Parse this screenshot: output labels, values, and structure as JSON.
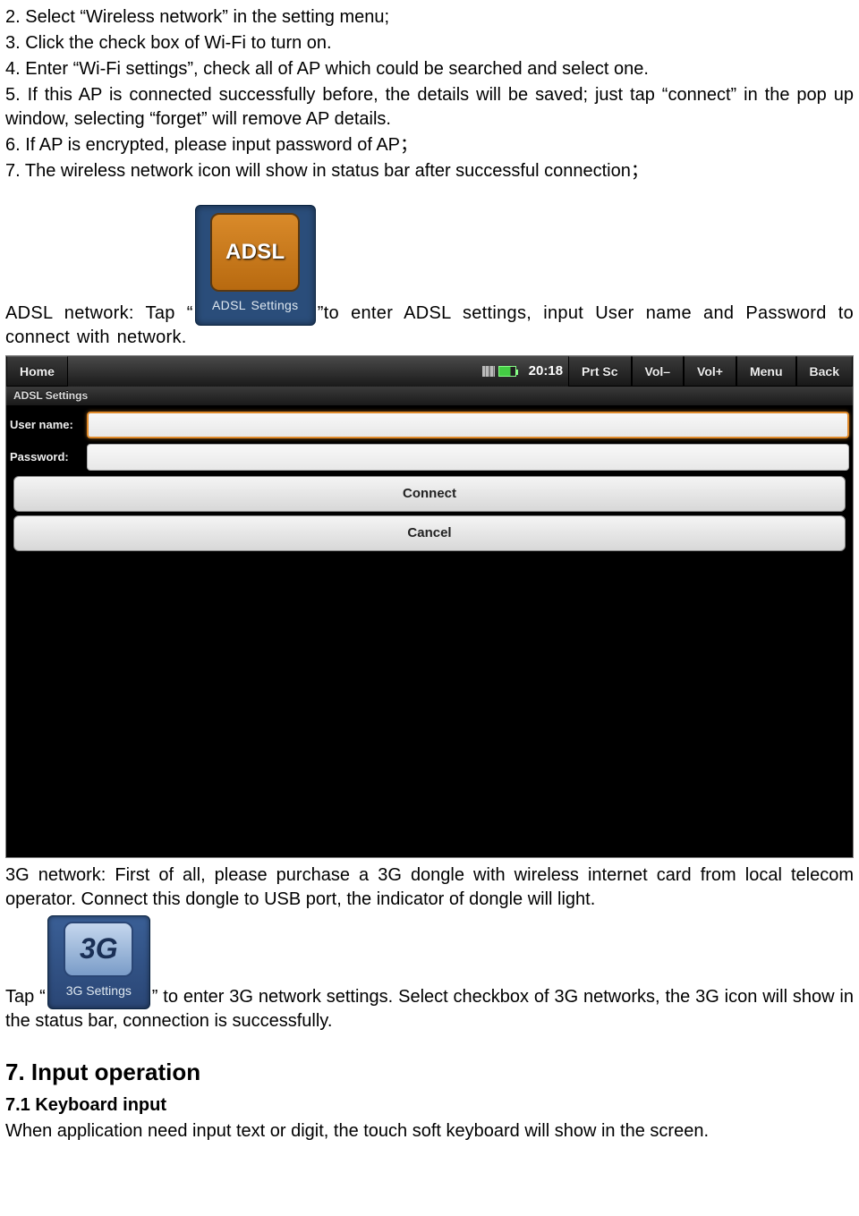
{
  "steps": {
    "s2": "2. Select “Wireless network” in the setting menu;",
    "s3": "3. Click the check box of Wi-Fi to turn on.",
    "s4": "4. Enter “Wi-Fi settings”, check all of AP which could be searched and select one.",
    "s5": "5. If this AP is connected successfully before, the details will be saved; just tap “connect” in the pop up window, selecting “forget” will remove AP details.",
    "s6": "6. If AP is encrypted, please input password of AP；",
    "s7": "7. The wireless network icon will show in status bar after successful connection；"
  },
  "adsl": {
    "prefix": "ADSL network: Tap “",
    "suffix": "”to enter ADSL settings, input User name and Password to connect with network.",
    "icon_text": "ADSL",
    "icon_label": "ADSL Settings"
  },
  "adsl_screenshot": {
    "topbar": {
      "home": "Home",
      "clock": "20:18",
      "buttons": [
        "Prt Sc",
        "Vol–",
        "Vol+",
        "Menu",
        "Back"
      ]
    },
    "subbar": "ADSL Settings",
    "labels": {
      "username": "User name:",
      "password": "Password:"
    },
    "buttons": {
      "connect": "Connect",
      "cancel": "Cancel"
    }
  },
  "g3": {
    "para1": "3G network: First of all, please purchase a 3G dongle with wireless internet card from local telecom operator. Connect this dongle to USB port, the indicator of dongle will light.",
    "prefix": "Tap “",
    "suffix": "” to enter 3G network settings. Select checkbox of 3G networks, the 3G icon will show in the status bar, connection is successfully.",
    "icon_text": "3G",
    "icon_label": "3G Settings"
  },
  "section7": {
    "heading": "7. Input operation",
    "sub": "7.1 Keyboard input",
    "body": "When application need input text or digit, the touch soft keyboard will show in the screen."
  }
}
